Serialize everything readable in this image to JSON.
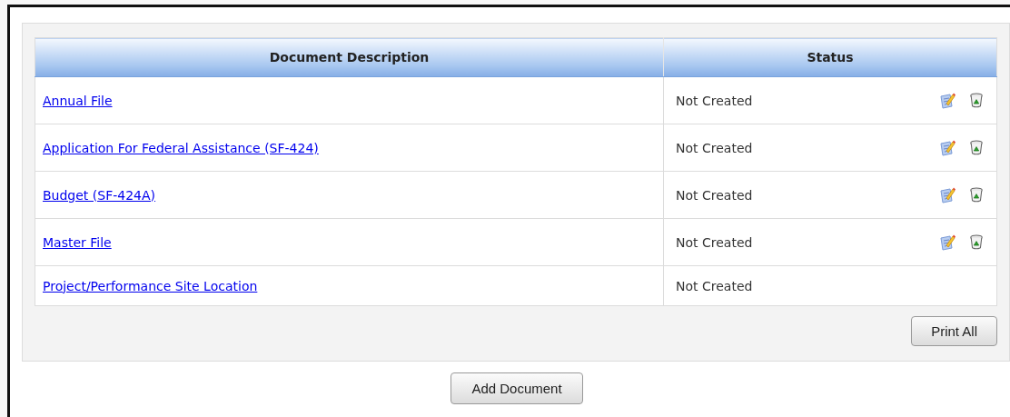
{
  "table": {
    "columns": [
      "Document Description",
      "Status"
    ],
    "rows": [
      {
        "document": "Annual File",
        "status": "Not Created",
        "editable": true,
        "deletable": true
      },
      {
        "document": "Application For Federal Assistance (SF-424)",
        "status": "Not Created",
        "editable": true,
        "deletable": true
      },
      {
        "document": "Budget (SF-424A)",
        "status": "Not Created",
        "editable": true,
        "deletable": true
      },
      {
        "document": "Master File",
        "status": "Not Created",
        "editable": true,
        "deletable": true
      },
      {
        "document": "Project/Performance Site Location",
        "status": "Not Created",
        "editable": false,
        "deletable": false
      }
    ]
  },
  "buttons": {
    "print_all": "Print All",
    "add_document": "Add Document"
  }
}
